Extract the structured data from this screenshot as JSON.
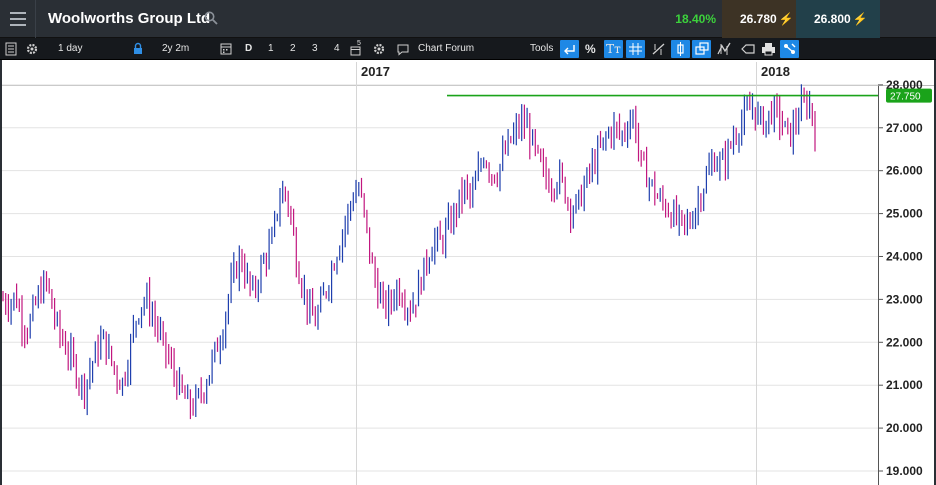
{
  "header": {
    "title": "Woolworths Group Ltd",
    "change_pct": "18.40%",
    "sell_price": "26.780",
    "buy_price": "26.800",
    "change_color": "#3cd23c",
    "sell_arrow_color": "#f7931e",
    "buy_arrow_color": "#29b6f6"
  },
  "toolbar": {
    "interval": "1 day",
    "period": "2y 2m",
    "period_buttons": [
      "D",
      "1",
      "2",
      "3",
      "4"
    ],
    "forum_label": "Chart Forum",
    "tools_label": "Tools",
    "percent_label": "%",
    "text_tool_label": "Tт",
    "calendar_badge": "5"
  },
  "chart_data": {
    "type": "candlestick",
    "x_labels": [
      "2017",
      "2018"
    ],
    "y_ticks": [
      "28.000",
      "27.000",
      "26.000",
      "25.000",
      "24.000",
      "23.000",
      "22.000",
      "21.000",
      "20.000",
      "19.000"
    ],
    "ylim": [
      19.0,
      28.3
    ],
    "horizontal_line": {
      "value": 27.75,
      "label": "27.750",
      "color": "#1aa31a"
    },
    "up_color": "#1f3fae",
    "down_color": "#c2177f",
    "approx_closes": [
      23.0,
      22.9,
      23.1,
      22.5,
      22.3,
      22.8,
      23.2,
      23.4,
      22.7,
      22.2,
      21.9,
      21.6,
      21.2,
      20.9,
      21.4,
      21.8,
      22.1,
      21.7,
      21.3,
      21.0,
      21.6,
      22.4,
      22.9,
      23.0,
      22.6,
      22.2,
      21.8,
      21.4,
      21.0,
      20.7,
      20.5,
      20.6,
      20.9,
      21.3,
      21.8,
      22.2,
      23.0,
      23.6,
      24.0,
      23.5,
      23.1,
      23.6,
      24.0,
      24.3,
      25.2,
      25.6,
      25.0,
      23.9,
      23.3,
      22.7,
      22.5,
      22.9,
      23.4,
      23.9,
      24.4,
      24.9,
      25.4,
      25.6,
      24.8,
      23.8,
      23.2,
      22.8,
      22.9,
      23.3,
      23.1,
      22.8,
      23.0,
      23.5,
      24.0,
      24.4,
      24.3,
      24.6,
      24.9,
      25.3,
      25.6,
      25.3,
      25.9,
      26.4,
      26.0,
      25.9,
      26.3,
      26.6,
      26.9,
      27.1,
      27.0,
      26.5,
      26.1,
      25.8,
      25.7,
      25.9,
      25.5,
      25.1,
      25.2,
      25.6,
      26.0,
      26.3,
      26.6,
      26.9,
      27.0,
      26.8,
      27.1,
      27.3,
      26.2,
      25.9,
      25.6,
      25.3,
      25.2,
      25.0,
      24.8,
      24.7,
      24.8,
      25.2,
      25.6,
      26.0,
      26.3,
      26.1,
      26.4,
      26.8,
      27.1,
      27.3,
      27.5,
      27.2,
      27.1,
      27.4,
      27.3,
      27.0,
      26.8,
      27.2,
      27.5,
      27.6,
      27.0
    ]
  }
}
